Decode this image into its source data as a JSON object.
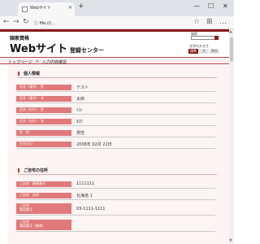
{
  "browser": {
    "tab_title": "Webサイト",
    "tab_close": "✕",
    "new_tab": "+",
    "win_min": "—",
    "win_max": "☐",
    "win_close": "✕",
    "back": "←",
    "forward": "→",
    "reload": "↻",
    "url": "ⓘ  file:///...",
    "tool_icons": [
      "☆",
      "⊞",
      "…"
    ]
  },
  "header": {
    "org": "国家資格",
    "title": "Webサイト",
    "subtitle": "登録センター",
    "search_label": "検索",
    "font_size_label": "文字の大きさ",
    "font_sizes": [
      "標準",
      "大",
      "特大"
    ]
  },
  "breadcrumb": [
    "トップページ",
    ">",
    "入力内容確認"
  ],
  "sections": [
    {
      "title": "個人情報",
      "rows": [
        {
          "label": "氏名（漢字）　姓",
          "value": "テスト"
        },
        {
          "label": "氏名（漢字）　名",
          "value": "太郎"
        },
        {
          "label": "氏名（ｶﾀｶﾅ）　姓",
          "value": "ﾃｽﾄ"
        },
        {
          "label": "氏名（ｶﾀｶﾅ）　名",
          "value": "ﾀﾛｳ"
        },
        {
          "label": "性　別",
          "value": "男性"
        },
        {
          "label": "生年月日",
          "value": "2008年 02月 22日"
        }
      ]
    },
    {
      "title": "ご自宅の住所",
      "rows": [
        {
          "label": "ご自宅　郵便番号",
          "value": "1111111"
        },
        {
          "label": "ご自宅　住所",
          "value": "北海道 1"
        },
        {
          "label": "ご自宅\n電話番号",
          "value": "03-1111-1111"
        },
        {
          "label": "ご自宅\n電話番号（携帯）",
          "value": ""
        }
      ]
    }
  ]
}
